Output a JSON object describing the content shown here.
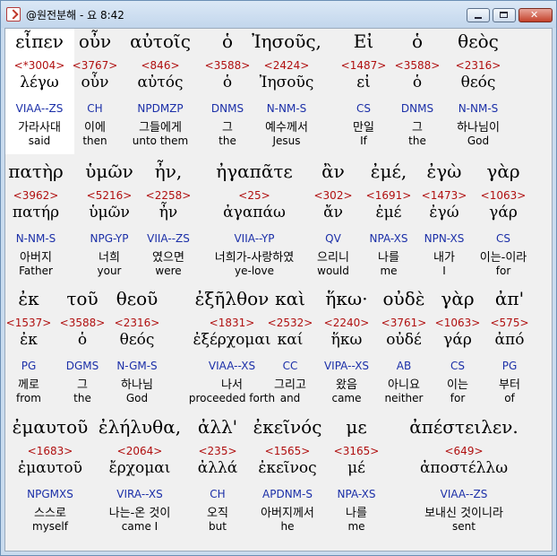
{
  "window": {
    "title": "@원전분해 - 요 8:42"
  },
  "rows": [
    {
      "words": [
        {
          "greek": "εἶπεν",
          "strong": "<*3004>",
          "lemma": "λέγω",
          "parse": "VIAA--ZS",
          "korean": "가라사대",
          "english": "said"
        },
        {
          "greek": "οὖν",
          "strong": "<3767>",
          "lemma": "οὖν",
          "parse": "CH",
          "korean": "이에",
          "english": "then"
        },
        {
          "greek": "αὐτοῖς",
          "strong": "<846>",
          "lemma": "αὐτός",
          "parse": "NPDMZP",
          "korean": "그들에게",
          "english": "unto them"
        },
        {
          "greek": "ὁ",
          "strong": "<3588>",
          "lemma": "ὁ",
          "parse": "DNMS",
          "korean": "그",
          "english": "the"
        },
        {
          "greek": "Ἰησοῦς,",
          "strong": "<2424>",
          "lemma": "Ἰησοῦς",
          "parse": "N-NM-S",
          "korean": "예수께서",
          "english": "Jesus"
        },
        {
          "greek": "Εἰ",
          "strong": "<1487>",
          "lemma": "εἰ",
          "parse": "CS",
          "korean": "만일",
          "english": "If"
        },
        {
          "greek": "ὁ",
          "strong": "<3588>",
          "lemma": "ὁ",
          "parse": "DNMS",
          "korean": "그",
          "english": "the"
        },
        {
          "greek": "θεὸς",
          "strong": "<2316>",
          "lemma": "θεός",
          "parse": "N-NM-S",
          "korean": "하나님이",
          "english": "God"
        }
      ]
    },
    {
      "words": [
        {
          "greek": "πατὴρ",
          "strong": "<3962>",
          "lemma": "πατήρ",
          "parse": "N-NM-S",
          "korean": "아버지",
          "english": "Father"
        },
        {
          "greek": "ὑμῶν",
          "strong": "<5216>",
          "lemma": "ὑμῶν",
          "parse": "NPG-YP",
          "korean": "너희",
          "english": "your"
        },
        {
          "greek": "ἦν,",
          "strong": "<2258>",
          "lemma": "ἦν",
          "parse": "VIIA--ZS",
          "korean": "였으면",
          "english": "were"
        },
        {
          "greek": "ἠγαπᾶτε",
          "strong": "<25>",
          "lemma": "ἀγαπάω",
          "parse": "VIIA--YP",
          "korean": "너희가-사랑하였",
          "english": "ye-love"
        },
        {
          "greek": "ἂν",
          "strong": "<302>",
          "lemma": "ἄν",
          "parse": "QV",
          "korean": "으리니",
          "english": "would"
        },
        {
          "greek": "ἐμέ,",
          "strong": "<1691>",
          "lemma": "ἐμέ",
          "parse": "NPA-XS",
          "korean": "나를",
          "english": "me"
        },
        {
          "greek": "ἐγὼ",
          "strong": "<1473>",
          "lemma": "ἐγώ",
          "parse": "NPN-XS",
          "korean": "내가",
          "english": "I"
        },
        {
          "greek": "γὰρ",
          "strong": "<1063>",
          "lemma": "γάρ",
          "parse": "CS",
          "korean": "이는-이라",
          "english": "for"
        }
      ]
    },
    {
      "words": [
        {
          "greek": "ἐκ",
          "strong": "<1537>",
          "lemma": "ἐκ",
          "parse": "PG",
          "korean": "께로",
          "english": "from"
        },
        {
          "greek": "τοῦ",
          "strong": "<3588>",
          "lemma": "ὁ",
          "parse": "DGMS",
          "korean": "그",
          "english": "the"
        },
        {
          "greek": "θεοῦ",
          "strong": "<2316>",
          "lemma": "θεός",
          "parse": "N-GM-S",
          "korean": "하나님",
          "english": "God"
        },
        {
          "greek": "ἐξῆλθον",
          "strong": "<1831>",
          "lemma": "ἐξέρχομαι",
          "parse": "VIAA--XS",
          "korean": "나서",
          "english": "proceeded forth"
        },
        {
          "greek": "καὶ",
          "strong": "<2532>",
          "lemma": "καί",
          "parse": "CC",
          "korean": "그리고",
          "english": "and"
        },
        {
          "greek": "ἥκω·",
          "strong": "<2240>",
          "lemma": "ἥκω",
          "parse": "VIPA--XS",
          "korean": "왔음",
          "english": "came"
        },
        {
          "greek": "οὐδὲ",
          "strong": "<3761>",
          "lemma": "οὐδέ",
          "parse": "AB",
          "korean": "아니요",
          "english": "neither"
        },
        {
          "greek": "γὰρ",
          "strong": "<1063>",
          "lemma": "γάρ",
          "parse": "CS",
          "korean": "이는",
          "english": "for"
        },
        {
          "greek": "ἀπ'",
          "strong": "<575>",
          "lemma": "ἀπό",
          "parse": "PG",
          "korean": "부터",
          "english": "of"
        }
      ]
    },
    {
      "words": [
        {
          "greek": "ἐμαυτοῦ",
          "strong": "<1683>",
          "lemma": "ἐμαυτοῦ",
          "parse": "NPGMXS",
          "korean": "스스로",
          "english": "myself"
        },
        {
          "greek": "ἐλήλυθα,",
          "strong": "<2064>",
          "lemma": "ἔρχομαι",
          "parse": "VIRA--XS",
          "korean": "나는-온 것이",
          "english": "came I"
        },
        {
          "greek": "ἀλλ'",
          "strong": "<235>",
          "lemma": "ἀλλά",
          "parse": "CH",
          "korean": "오직",
          "english": "but"
        },
        {
          "greek": "ἐκεῖνός",
          "strong": "<1565>",
          "lemma": "ἐκεῖνος",
          "parse": "APDNM-S",
          "korean": "아버지께서",
          "english": "he"
        },
        {
          "greek": "με",
          "strong": "<3165>",
          "lemma": "μέ",
          "parse": "NPA-XS",
          "korean": "나를",
          "english": "me"
        },
        {
          "greek": "ἀπέστειλεν.",
          "strong": "<649>",
          "lemma": "ἀποστέλλω",
          "parse": "VIAA--ZS",
          "korean": "보내신 것이니라",
          "english": "sent"
        }
      ]
    }
  ]
}
